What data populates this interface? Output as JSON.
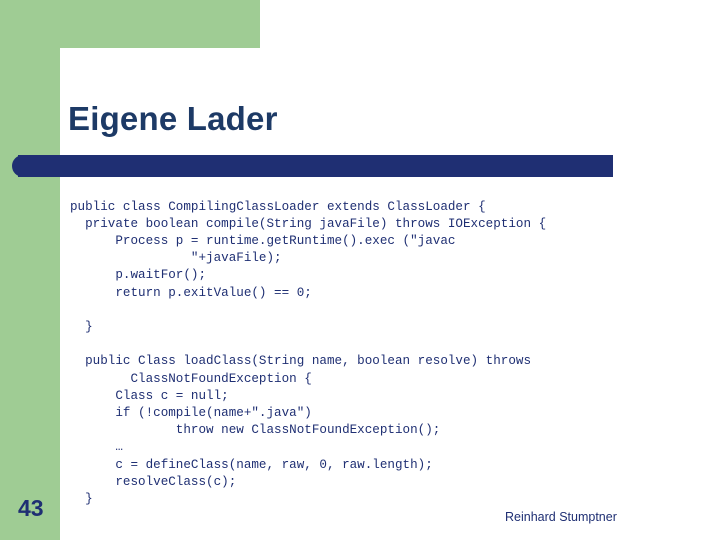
{
  "slide": {
    "title": "Eigene Lader",
    "page_number": "43",
    "footer_author": "Reinhard Stumptner",
    "colors": {
      "green_band": "#9fcc94",
      "dark_blue": "#1f2f73",
      "title_blue": "#1d3a66",
      "background": "#ffffff"
    },
    "code_lines": [
      {
        "indent": 0,
        "parts": [
          {
            "t": "public class ",
            "bold": true
          },
          {
            "t": "Compiling",
            "bold": true
          },
          {
            "t": "Class",
            "bold": true
          },
          {
            "t": "Loader ",
            "bold": true
          },
          {
            "t": "extends ",
            "bold": true
          },
          {
            "t": "Class",
            "bold": true
          },
          {
            "t": "Loader {",
            "bold": true
          }
        ]
      },
      {
        "indent": 2,
        "parts": [
          {
            "t": "private boolean ",
            "bold": true
          },
          {
            "t": "compile",
            "bold": true
          },
          {
            "t": "(String javaFile) ",
            "bold": false
          },
          {
            "t": "throws ",
            "bold": true
          },
          {
            "t": "IOException {",
            "bold": false
          }
        ]
      },
      {
        "indent": 6,
        "parts": [
          {
            "t": "Process p = runtime.",
            "bold": false
          },
          {
            "t": "get",
            "bold": false
          },
          {
            "t": "Runtime().",
            "bold": false
          },
          {
            "t": "exec ",
            "bold": false
          },
          {
            "t": "(\"javac",
            "bold": false
          }
        ]
      },
      {
        "indent": 16,
        "parts": [
          {
            "t": "\"+javaFile);",
            "bold": false
          }
        ]
      },
      {
        "indent": 6,
        "parts": [
          {
            "t": "p.",
            "bold": false
          },
          {
            "t": "wait",
            "bold": false
          },
          {
            "t": "For();",
            "bold": false
          }
        ]
      },
      {
        "indent": 6,
        "parts": [
          {
            "t": "return p.",
            "bold": false
          },
          {
            "t": "exit",
            "bold": false
          },
          {
            "t": "Value() == 0;",
            "bold": false
          }
        ]
      },
      {
        "indent": 0,
        "parts": []
      },
      {
        "indent": 2,
        "parts": [
          {
            "t": "}",
            "bold": false
          }
        ]
      },
      {
        "indent": 0,
        "parts": []
      },
      {
        "indent": 2,
        "parts": [
          {
            "t": "public Class ",
            "bold": true
          },
          {
            "t": "load",
            "bold": true
          },
          {
            "t": "Class",
            "bold": true
          },
          {
            "t": "(String name, boolean resolve) throws",
            "bold": false
          }
        ]
      },
      {
        "indent": 8,
        "parts": [
          {
            "t": "Class",
            "bold": false
          },
          {
            "t": "Not",
            "bold": false
          },
          {
            "t": "Found",
            "bold": false
          },
          {
            "t": "Exception {",
            "bold": false
          }
        ]
      },
      {
        "indent": 6,
        "parts": [
          {
            "t": "Class c = null;",
            "bold": false
          }
        ]
      },
      {
        "indent": 6,
        "parts": [
          {
            "t": "if (!compile(name+\".java\")",
            "bold": false
          }
        ]
      },
      {
        "indent": 14,
        "parts": [
          {
            "t": "throw new Class",
            "bold": false
          },
          {
            "t": "Not",
            "bold": false
          },
          {
            "t": "Found",
            "bold": false
          },
          {
            "t": "Exception();",
            "bold": false
          }
        ]
      },
      {
        "indent": 6,
        "parts": [
          {
            "t": "…",
            "bold": false
          }
        ]
      },
      {
        "indent": 6,
        "parts": [
          {
            "t": "c = define",
            "bold": false
          },
          {
            "t": "Class(name, raw, 0, raw.length);",
            "bold": false
          }
        ]
      },
      {
        "indent": 6,
        "parts": [
          {
            "t": "resolve",
            "bold": false
          },
          {
            "t": "Class(c);",
            "bold": false
          }
        ]
      },
      {
        "indent": 2,
        "parts": [
          {
            "t": "}",
            "bold": false
          }
        ]
      }
    ],
    "code_text": "public class CompilingClassLoader extends ClassLoader {\n  private boolean compile(String javaFile) throws IOException {\n      Process p = runtime.getRuntime().exec (\"javac\n                \"+javaFile);\n      p.waitFor();\n      return p.exitValue() == 0;\n\n  }\n\n  public Class loadClass(String name, boolean resolve) throws\n        ClassNotFoundException {\n      Class c = null;\n      if (!compile(name+\".java\")\n              throw new ClassNotFoundException();\n      …\n      c = defineClass(name, raw, 0, raw.length);\n      resolveClass(c);\n  }"
  }
}
